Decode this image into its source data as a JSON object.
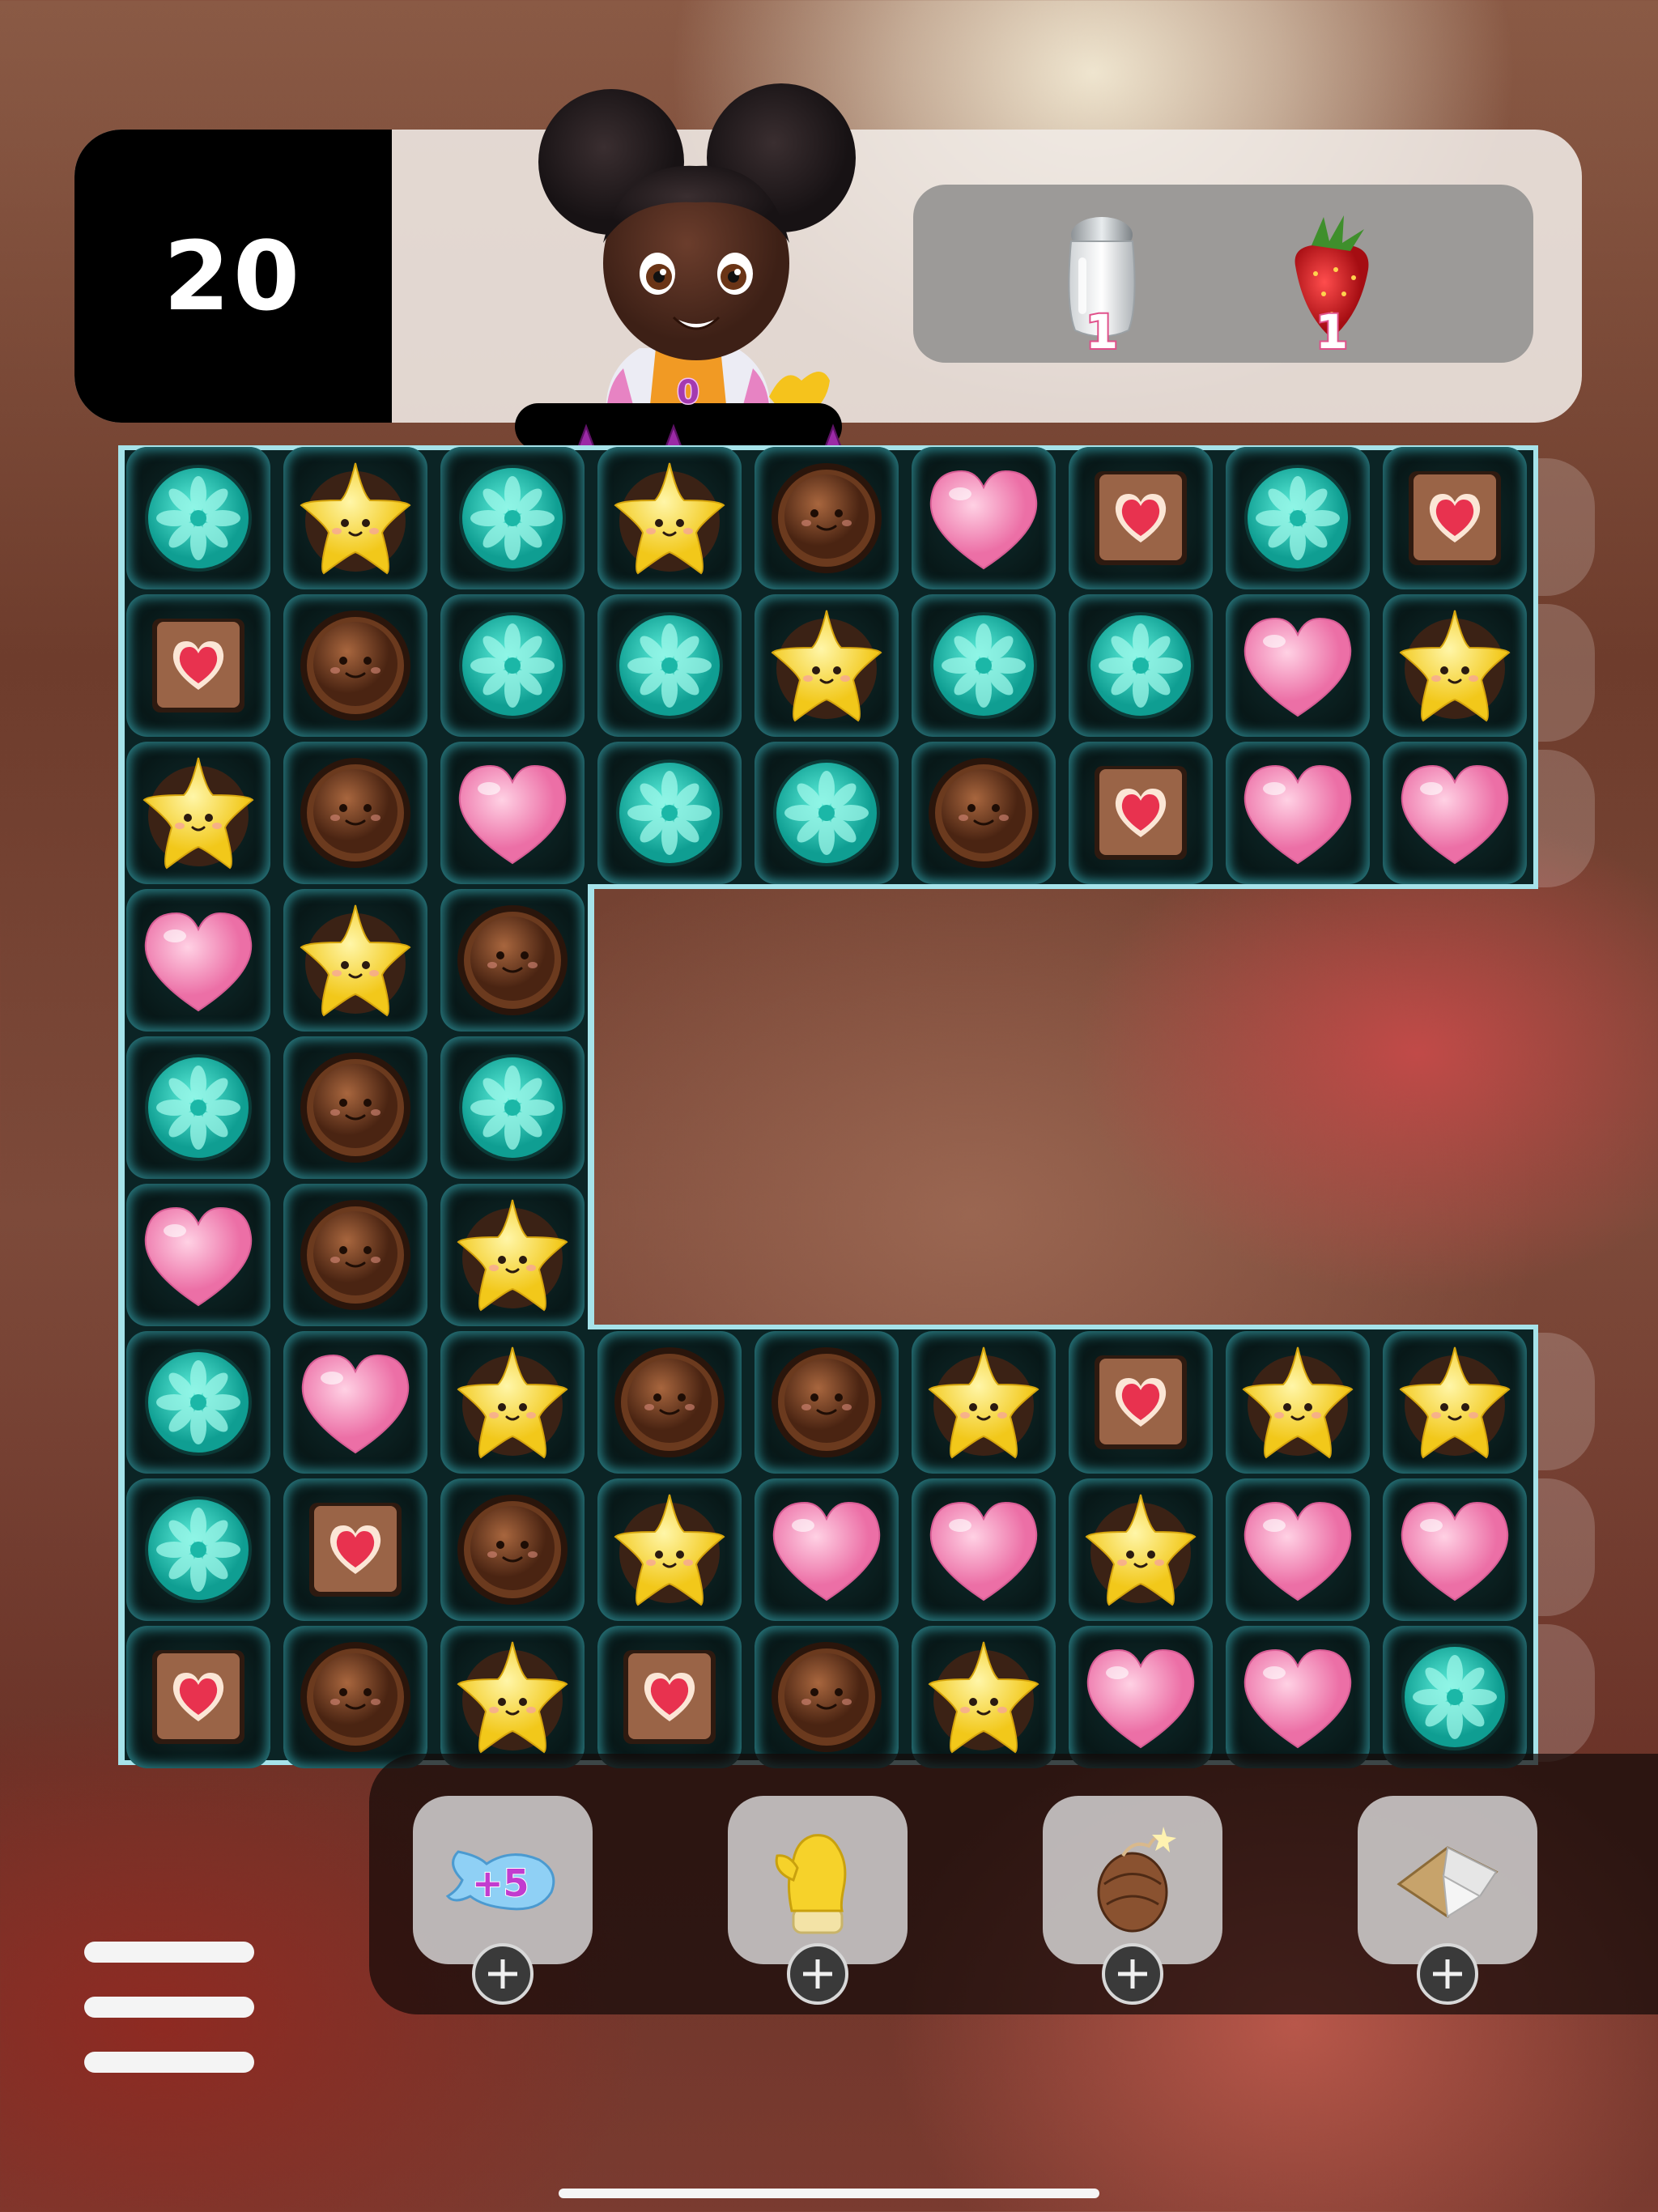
{
  "moves_left": "20",
  "score": "0",
  "goals": [
    {
      "icon": "sugar-shaker-icon",
      "count": "1"
    },
    {
      "icon": "strawberry-icon",
      "count": "1"
    }
  ],
  "stars_earned": 0,
  "board": [
    [
      "T",
      "S",
      "T",
      "S",
      "C",
      "H",
      "B",
      "T",
      "B"
    ],
    [
      "B",
      "C",
      "T",
      "T",
      "S",
      "T",
      "T",
      "H",
      "S"
    ],
    [
      "S",
      "C",
      "H",
      "T",
      "T",
      "C",
      "B",
      "H",
      "H"
    ],
    [
      "H",
      "S",
      "C",
      "",
      "",
      "",
      "",
      "",
      ""
    ],
    [
      "T",
      "C",
      "T",
      "",
      "",
      "",
      "",
      "",
      ""
    ],
    [
      "H",
      "C",
      "S",
      "",
      "",
      "",
      "",
      "",
      ""
    ],
    [
      "T",
      "H",
      "S",
      "C",
      "C",
      "S",
      "B",
      "S",
      "S"
    ],
    [
      "T",
      "B",
      "C",
      "S",
      "H",
      "H",
      "S",
      "H",
      "H"
    ],
    [
      "B",
      "C",
      "S",
      "B",
      "C",
      "S",
      "H",
      "H",
      "T"
    ]
  ],
  "candy_legend": {
    "T": "teal-flower-candy",
    "S": "yellow-star-candy",
    "C": "chocolate-truffle-candy",
    "H": "pink-heart-candy",
    "B": "heart-cookie-box-candy"
  },
  "boosters": [
    {
      "name": "plus-five-moves",
      "label": "+5"
    },
    {
      "name": "yellow-glove"
    },
    {
      "name": "chocolate-bomb"
    },
    {
      "name": "wrapper-paper"
    }
  ],
  "colors": {
    "board_border": "#a6e3ea",
    "panel_black": "#000000",
    "accent_purple": "#9b2aa6"
  }
}
